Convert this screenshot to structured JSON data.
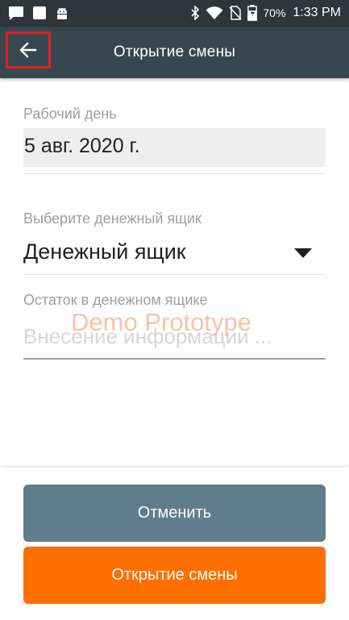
{
  "status_bar": {
    "left_icons": [
      "message-icon",
      "notification-square-icon",
      "android-icon"
    ],
    "right_icons": [
      "bluetooth-icon",
      "wifi-icon",
      "no-sim-icon",
      "battery-charging-icon"
    ],
    "battery_percent": "70%",
    "time": "1:33 PM"
  },
  "app_bar": {
    "title": "Открытие смены",
    "back_icon": "arrow-left-icon",
    "highlight_color": "#e02020",
    "background_color": "#37474f"
  },
  "form": {
    "workday": {
      "label": "Рабочий день",
      "value": "5 авг. 2020 г."
    },
    "cash_drawer": {
      "label": "Выберите денежный ящик",
      "selected": "Денежный ящик"
    },
    "balance": {
      "label": "Остаток в денежном ящике",
      "placeholder": "Внесение информации ...",
      "value": ""
    }
  },
  "watermark": "Demo Prototype",
  "buttons": {
    "cancel": "Отменить",
    "open_shift": "Открытие смены"
  },
  "colors": {
    "cancel_button": "#607d8b",
    "open_button": "#ff6f00"
  }
}
